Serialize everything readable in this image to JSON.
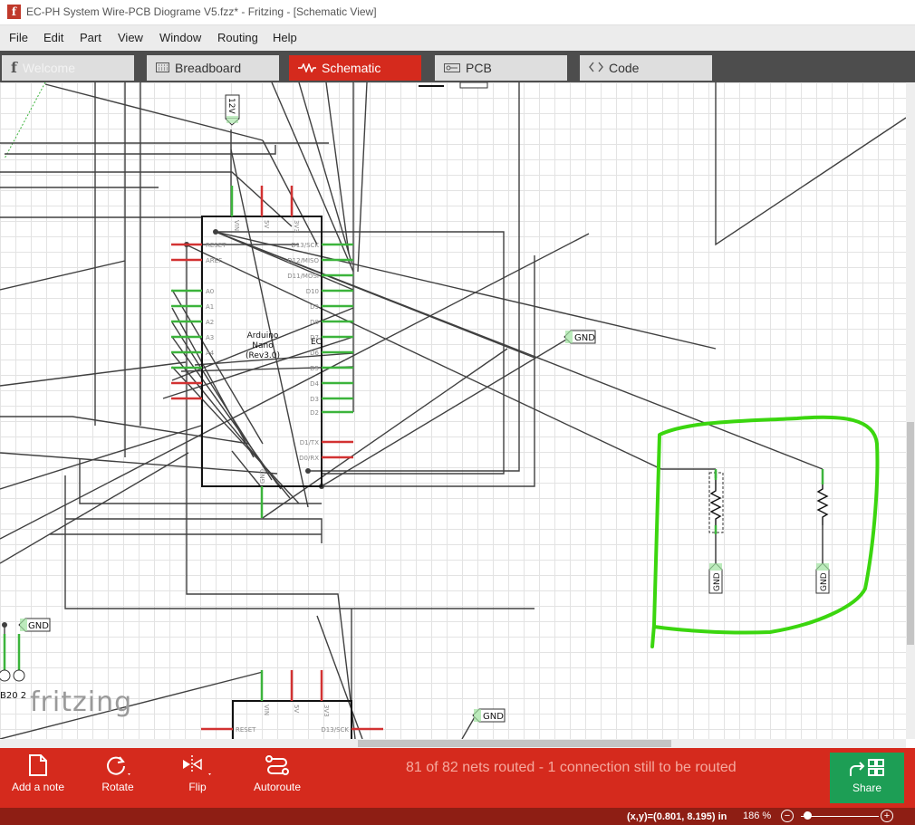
{
  "window": {
    "title": "EC-PH System Wire-PCB Diograme V5.fzz* - Fritzing - [Schematic View]",
    "app_icon": "f"
  },
  "menu": [
    "File",
    "Edit",
    "Part",
    "View",
    "Window",
    "Routing",
    "Help"
  ],
  "tabs": [
    {
      "label": "Welcome",
      "icon": "fritzing-f-icon",
      "active": false
    },
    {
      "label": "Breadboard",
      "icon": "breadboard-icon",
      "active": false
    },
    {
      "label": "Schematic",
      "icon": "resistor-wave-icon",
      "active": true
    },
    {
      "label": "PCB",
      "icon": "pcb-icon",
      "active": false
    },
    {
      "label": "Code",
      "icon": "code-brackets-icon",
      "active": false
    }
  ],
  "schematic": {
    "power_label": "12V",
    "gnd_label": "GND",
    "arduino_name": "Arduino\nNano\n(Rev3.0)",
    "arduino_name_lines": [
      "Arduino",
      "Nano",
      "(Rev3.0)"
    ],
    "part_ref": "EC",
    "left_pins": [
      "RESET",
      "AREF",
      "A0",
      "A1",
      "A2",
      "A3",
      "A4"
    ],
    "right_pins": [
      "D13/SCK",
      "D12/MISO",
      "D11/MOSI",
      "D10",
      "D9",
      "D8",
      "D7",
      "D6",
      "D5",
      "D4",
      "D3",
      "D2",
      "D1/TX",
      "D0/RX"
    ],
    "top_pins": [
      "VIN",
      "5V",
      "3V3"
    ],
    "bottom_pin": "GND",
    "bottom_part_pins": [
      "RESET",
      "D13/SCK",
      "VIN",
      "5V",
      "3V3"
    ],
    "sensor_label": "B20 2",
    "annotation_color": "#3bd60f"
  },
  "watermark": "fritzing",
  "toolbar": {
    "add_note": "Add a note",
    "rotate": "Rotate",
    "flip": "Flip",
    "autoroute": "Autoroute",
    "routing_status": "81 of 82 nets routed - 1 connection still to be routed",
    "share": "Share"
  },
  "status": {
    "coords": "(x,y)=(0.801, 8.195) in",
    "zoom": "186",
    "zoom_unit": "%"
  },
  "colors": {
    "accent": "#d52a1d",
    "share": "#1d9e55",
    "status_bar": "#8e1e14",
    "wire": "#404040",
    "pin_connected": "#3cb43c",
    "pin_unconnected": "#d23232"
  }
}
